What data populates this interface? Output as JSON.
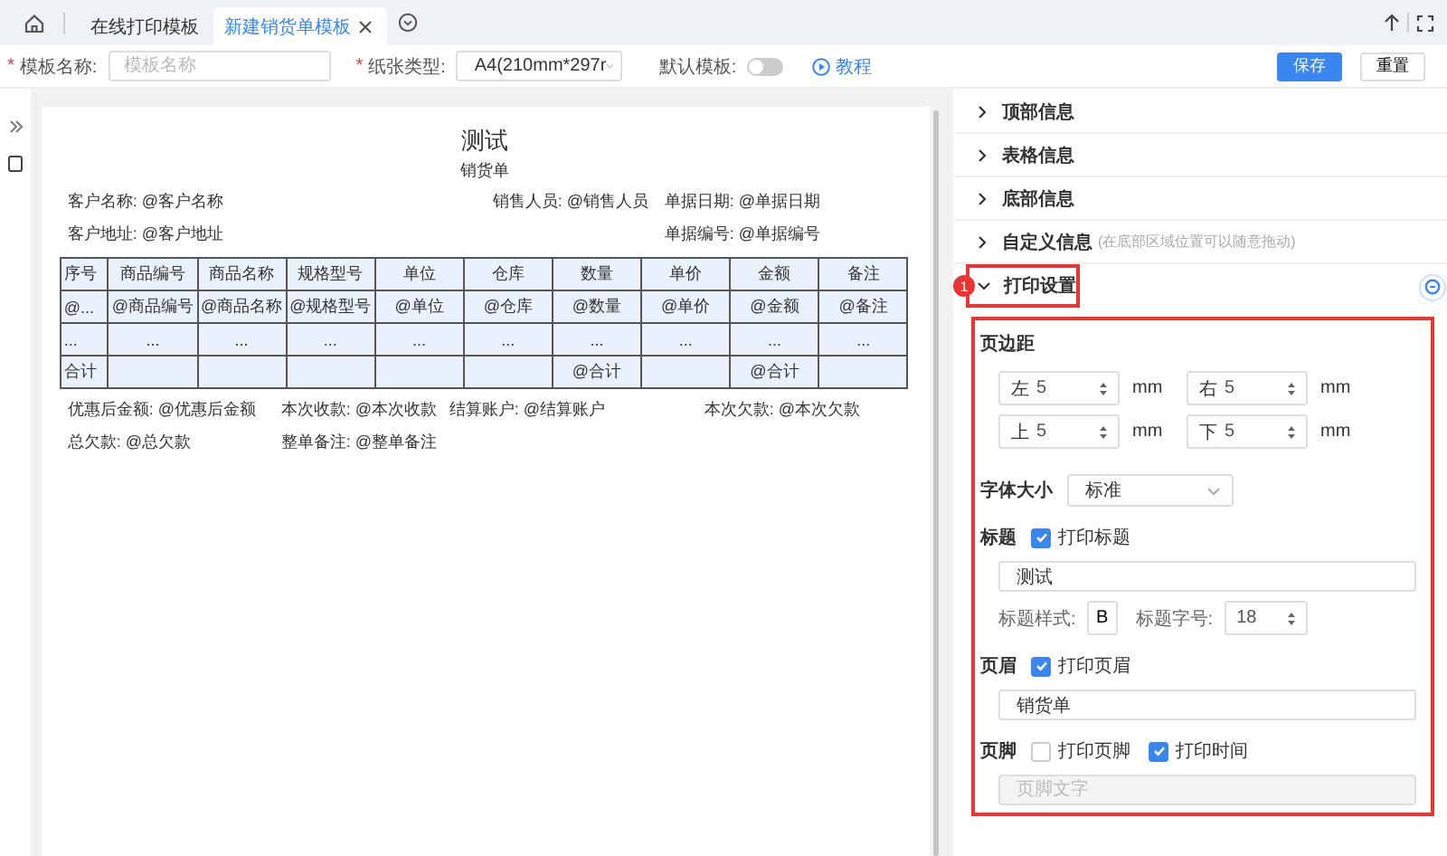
{
  "tabs": [
    {
      "label": "在线打印模板",
      "selected": false
    },
    {
      "label": "新建销货单模板",
      "selected": true
    }
  ],
  "toolbar": {
    "fields": [
      {
        "kind": "input",
        "required_mark": "*",
        "label": "模板名称:",
        "placeholder": "模板名称"
      },
      {
        "kind": "select",
        "required_mark": "*",
        "label": "纸张类型:",
        "value": "A4(210mm*297r"
      }
    ],
    "default_toggle": {
      "label": "默认模板:",
      "on": false
    },
    "tutorial_link": "教程",
    "buttons": [
      {
        "label": "保存",
        "kind": "primary"
      },
      {
        "label": "重置",
        "kind": "default"
      }
    ]
  },
  "document": {
    "title": "测试",
    "subtitle": "销货单",
    "info_rows": [
      [
        "客户名称: @客户名称",
        "销售人员: @销售人员",
        "单据日期: @单据日期"
      ],
      [
        "客户地址: @客户地址",
        "单据编号: @单据编号"
      ]
    ],
    "table": {
      "columns": [
        "序号",
        "商品编号",
        "商品名称",
        "规格型号",
        "单位",
        "仓库",
        "数量",
        "单价",
        "金额",
        "备注"
      ],
      "rows": [
        [
          "@...",
          "@商品编号",
          "@商品名称",
          "@规格型号",
          "@单位",
          "@仓库",
          "@数量",
          "@单价",
          "@金额",
          "@备注"
        ],
        [
          "...",
          "...",
          "...",
          "...",
          "...",
          "...",
          "...",
          "...",
          "...",
          "..."
        ],
        [
          "合计",
          null,
          null,
          null,
          null,
          null,
          "@合计",
          null,
          "@合计",
          null
        ]
      ]
    },
    "footer_rows": [
      [
        "优惠后金额: @优惠后金额",
        "本次收款: @本次收款",
        "结算账户: @结算账户",
        "本次欠款: @本次欠款"
      ],
      [
        "总欠款: @总欠款",
        "整单备注: @整单备注"
      ]
    ]
  },
  "panel": {
    "sections": [
      {
        "title": "顶部信息",
        "expanded": false,
        "highlighted": false
      },
      {
        "title": "表格信息",
        "expanded": false,
        "highlighted": false
      },
      {
        "title": "底部信息",
        "expanded": false,
        "highlighted": false
      },
      {
        "title": "自定义信息",
        "hint": "(在底部区域位置可以随意拖动)",
        "expanded": false,
        "highlighted": false
      },
      {
        "title": "打印设置",
        "expanded": true,
        "highlighted": true,
        "badge": "1"
      }
    ],
    "print_settings": {
      "highlighted": true,
      "margin_label": "页边距",
      "margins": [
        {
          "prefix": "左",
          "value": "5",
          "unit": "mm"
        },
        {
          "prefix": "右",
          "value": "5",
          "unit": "mm"
        },
        {
          "prefix": "上",
          "value": "5",
          "unit": "mm"
        },
        {
          "prefix": "下",
          "value": "5",
          "unit": "mm"
        }
      ],
      "font_size": {
        "label": "字体大小",
        "value": "标准"
      },
      "title": {
        "label": "标题",
        "checkboxes": [
          {
            "label": "打印标题",
            "checked": true
          }
        ],
        "value": "测试",
        "style_label": "标题样式:",
        "bold_button": "B",
        "size_label": "标题字号:",
        "size": "18"
      },
      "header": {
        "label": "页眉",
        "checkboxes": [
          {
            "label": "打印页眉",
            "checked": true
          }
        ],
        "value": "销货单"
      },
      "footer": {
        "label": "页脚",
        "checkboxes": [
          {
            "label": "打印页脚",
            "checked": false
          },
          {
            "label": "打印时间",
            "checked": true
          }
        ],
        "placeholder": "页脚文字",
        "disabled": true
      }
    }
  }
}
